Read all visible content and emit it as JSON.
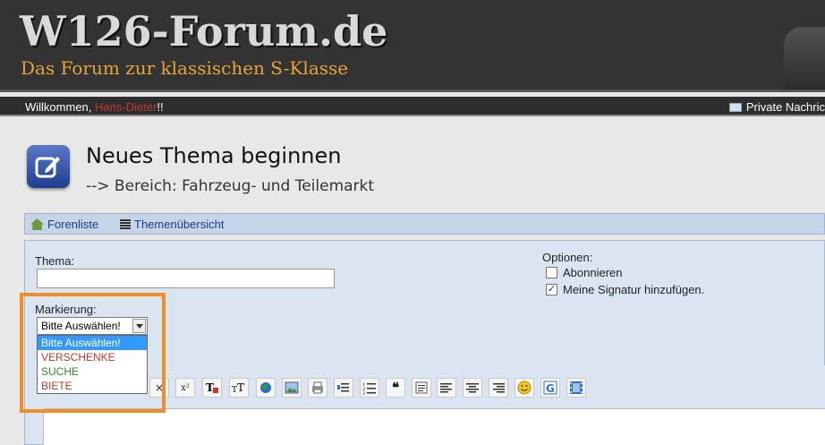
{
  "header": {
    "logo": "W126-Forum.de",
    "tagline": "Das Forum zur klassischen S-Klasse"
  },
  "userbar": {
    "welcome_prefix": "Willkommen, ",
    "username": "Hans-Dieter",
    "welcome_suffix": "!!",
    "pm_label": "Private Nachric"
  },
  "page": {
    "title": "Neues Thema beginnen",
    "subtitle": "--> Bereich: Fahrzeug- und Teilemarkt"
  },
  "nav": {
    "forenliste": "Forenliste",
    "themenuebersicht": "Themenübersicht"
  },
  "form": {
    "thema_label": "Thema:",
    "thema_value": "",
    "markierung_label": "Markierung:",
    "markierung_selected": "Bitte Auswählen!",
    "markierung_options": [
      "Bitte Auswählen!",
      "VERSCHENKE",
      "SUCHE",
      "BIETE"
    ],
    "options_label": "Optionen:",
    "abonnieren": {
      "label": "Abonnieren",
      "checked": false
    },
    "signatur": {
      "label": "Meine Signatur hinzufügen.",
      "checked": true
    }
  },
  "toolbar": {
    "buttons": [
      "close",
      "superscript",
      "font-color",
      "font-size",
      "link",
      "image",
      "print",
      "indent",
      "ordered-list",
      "quote",
      "code",
      "align-left",
      "align-center",
      "align-right",
      "smiley",
      "google",
      "video"
    ],
    "x_symbol": "×",
    "sup_symbol": "x²",
    "quote_symbol": "❝"
  },
  "colors": {
    "accent_orange": "#f28c28",
    "nav_blue": "#1a3d8a"
  }
}
